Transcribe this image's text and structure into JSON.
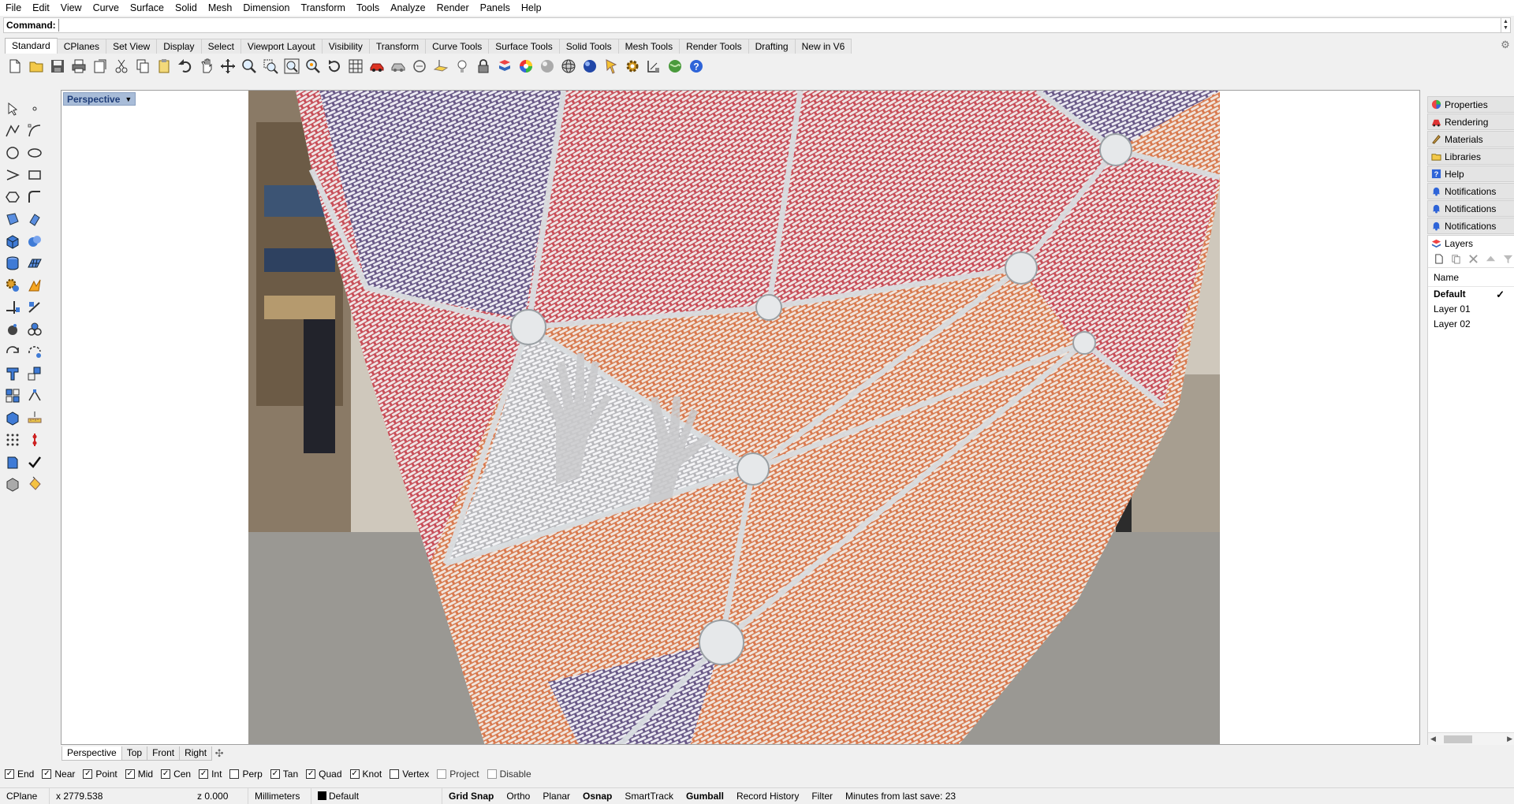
{
  "menu": [
    "File",
    "Edit",
    "View",
    "Curve",
    "Surface",
    "Solid",
    "Mesh",
    "Dimension",
    "Transform",
    "Tools",
    "Analyze",
    "Render",
    "Panels",
    "Help"
  ],
  "command": {
    "label": "Command:",
    "value": ""
  },
  "toolbar_tabs": [
    "Standard",
    "CPlanes",
    "Set View",
    "Display",
    "Select",
    "Viewport Layout",
    "Visibility",
    "Transform",
    "Curve Tools",
    "Surface Tools",
    "Solid Tools",
    "Mesh Tools",
    "Render Tools",
    "Drafting",
    "New in V6"
  ],
  "toolbar_icons": [
    "new-file",
    "open-file",
    "save",
    "print",
    "import",
    "cut",
    "copy",
    "paste",
    "undo",
    "pan",
    "move-view",
    "zoom",
    "zoom-window",
    "zoom-extents",
    "zoom-selected",
    "rotate-view",
    "grid",
    "car-render",
    "mesh-render",
    "circle-dot",
    "cplane",
    "light-bulb",
    "lock",
    "layer-material",
    "color-wheel",
    "sphere-shaded",
    "sphere-wire",
    "sphere-render",
    "spotlight",
    "gear-settings",
    "dimension",
    "globe",
    "help"
  ],
  "viewport": {
    "label": "Perspective",
    "tabs": [
      "Perspective",
      "Top",
      "Front",
      "Right"
    ]
  },
  "osnaps": [
    {
      "label": "End",
      "checked": true
    },
    {
      "label": "Near",
      "checked": true
    },
    {
      "label": "Point",
      "checked": true
    },
    {
      "label": "Mid",
      "checked": true
    },
    {
      "label": "Cen",
      "checked": true
    },
    {
      "label": "Int",
      "checked": true
    },
    {
      "label": "Perp",
      "checked": false
    },
    {
      "label": "Tan",
      "checked": true
    },
    {
      "label": "Quad",
      "checked": true
    },
    {
      "label": "Knot",
      "checked": true
    },
    {
      "label": "Vertex",
      "checked": false
    },
    {
      "label": "Project",
      "checked": false
    },
    {
      "label": "Disable",
      "checked": false
    }
  ],
  "status": {
    "cplane": "CPlane",
    "x": "x 2779.538",
    "z": "z 0.000",
    "units": "Millimeters",
    "layer": "Default",
    "grid_snap": "Grid Snap",
    "ortho": "Ortho",
    "planar": "Planar",
    "osnap": "Osnap",
    "smarttrack": "SmartTrack",
    "gumball": "Gumball",
    "record_history": "Record History",
    "filter": "Filter",
    "save_info": "Minutes from last save: 23"
  },
  "panel_tabs": [
    {
      "label": "Properties",
      "icon": "properties-icon"
    },
    {
      "label": "Rendering",
      "icon": "rendering-icon"
    },
    {
      "label": "Materials",
      "icon": "materials-icon"
    },
    {
      "label": "Libraries",
      "icon": "libraries-icon"
    },
    {
      "label": "Help",
      "icon": "help-icon"
    },
    {
      "label": "Notifications",
      "icon": "bell-icon"
    },
    {
      "label": "Notifications",
      "icon": "bell-icon"
    },
    {
      "label": "Notifications",
      "icon": "bell-icon"
    },
    {
      "label": "Layers",
      "icon": "layers-icon"
    }
  ],
  "layers": {
    "header": "Name",
    "rows": [
      {
        "name": "Default",
        "current": true
      },
      {
        "name": "Layer 01",
        "current": false
      },
      {
        "name": "Layer 02",
        "current": false
      }
    ]
  }
}
